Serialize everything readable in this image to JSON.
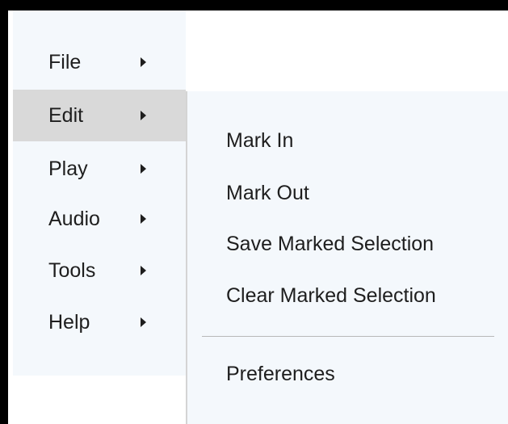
{
  "main_menu": {
    "items": [
      {
        "label": "File",
        "has_submenu": true,
        "highlighted": false
      },
      {
        "label": "Edit",
        "has_submenu": true,
        "highlighted": true
      },
      {
        "label": "Play",
        "has_submenu": true,
        "highlighted": false
      },
      {
        "label": "Audio",
        "has_submenu": true,
        "highlighted": false
      },
      {
        "label": "Tools",
        "has_submenu": true,
        "highlighted": false
      },
      {
        "label": "Help",
        "has_submenu": true,
        "highlighted": false
      }
    ]
  },
  "edit_submenu": {
    "items": [
      {
        "label": "Mark In"
      },
      {
        "label": "Mark Out"
      },
      {
        "label": "Save Marked Selection"
      },
      {
        "label": "Clear Marked Selection"
      },
      {
        "label": "Preferences"
      }
    ]
  },
  "icons": {
    "submenu_arrow": "triangle-right-icon"
  },
  "colors": {
    "menu_background": "#f4f8fc",
    "highlight": "#d9d9d9",
    "text": "#1e1e1e",
    "separator": "#b8b8b8",
    "frame_border": "#000000"
  }
}
